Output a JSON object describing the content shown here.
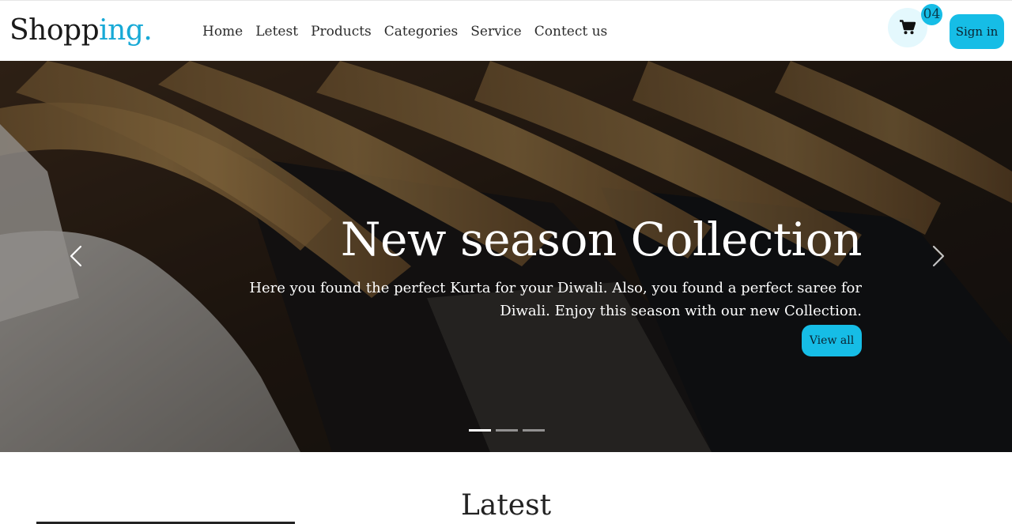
{
  "brand": {
    "part1": "Shopp",
    "part2": "ing."
  },
  "nav": {
    "links": [
      "Home",
      "Letest",
      "Products",
      "Categories",
      "Service",
      "Contect us"
    ]
  },
  "cart": {
    "icon": "cart-icon",
    "count": "04"
  },
  "signin": {
    "label": "Sign in"
  },
  "hero": {
    "title": "New season Collection",
    "text": "Here you found the perfect Kurta for your Diwali. Also, you found a perfect saree for Diwali. Enjoy this season with our new Collection.",
    "button": "View all",
    "slides": 3,
    "active_slide": 1
  },
  "latest": {
    "title": "Latest"
  },
  "colors": {
    "accent": "#16bde6",
    "brand_accent": "#17a9d6",
    "cart_bg": "#e4f8fd"
  }
}
